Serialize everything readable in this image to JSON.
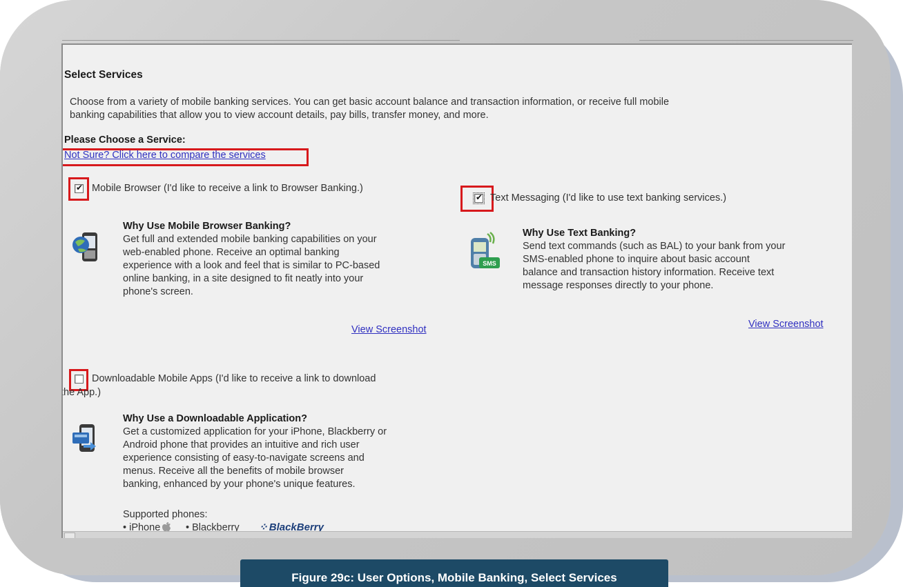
{
  "section": {
    "title": "Select Services",
    "intro_line1": "Choose from a variety of mobile banking services. You can get basic account balance and transaction information, or receive full mobile",
    "intro_line2": "banking capabilities that allow you to view account details, pay bills, transfer money, and more.",
    "choose_label": "Please Choose a Service:",
    "compare_link": "Not Sure? Click here to compare the services"
  },
  "services": {
    "browser": {
      "checked": true,
      "label": "Mobile Browser (I'd like to receive a link to Browser Banking.)",
      "heading": "Why Use Mobile Browser Banking?",
      "lines": [
        "Get full and extended mobile banking capabilities on your",
        "web-enabled phone. Receive an optimal banking",
        "experience with a look and feel that is similar to PC-based",
        "online banking, in a site designed to fit neatly into your",
        "phone's screen."
      ],
      "screenshot_link": "View Screenshot",
      "icon": "mobile-browser-icon"
    },
    "text": {
      "checked": true,
      "label": "Text Messaging (I'd like to use text banking services.)",
      "heading": "Why Use Text Banking?",
      "lines": [
        "Send text commands (such as BAL) to your bank from your",
        "SMS-enabled phone to inquire about basic account",
        "balance and transaction history information. Receive text",
        "message responses directly to your phone."
      ],
      "screenshot_link": "View Screenshot",
      "icon": "sms-phone-icon",
      "icon_badge": "SMS"
    },
    "apps": {
      "checked": false,
      "label_line1": "Downloadable Mobile Apps (I'd like to receive a link to download",
      "label_line2": "the App.)",
      "heading": "Why Use a Downloadable Application?",
      "lines": [
        "Get a customized application for your iPhone, Blackberry or",
        "Android phone that provides an intuitive and rich user",
        "experience consisting of easy-to-navigate screens and",
        "menus. Receive all the benefits of mobile browser",
        "banking, enhanced by your phone's unique features."
      ],
      "supported_label": "Supported phones:",
      "phones": [
        "• iPhone",
        "• Blackberry"
      ],
      "blackberry_logo": "BlackBerry",
      "icon": "downloadable-app-icon"
    }
  },
  "checkmark": "✔",
  "caption": "Figure 29c: User Options, Mobile Banking, Select Services",
  "colors": {
    "highlight": "#d7191c",
    "link": "#3030c0",
    "caption_bg": "#1d4a66",
    "frame": "#c4c4c4"
  }
}
